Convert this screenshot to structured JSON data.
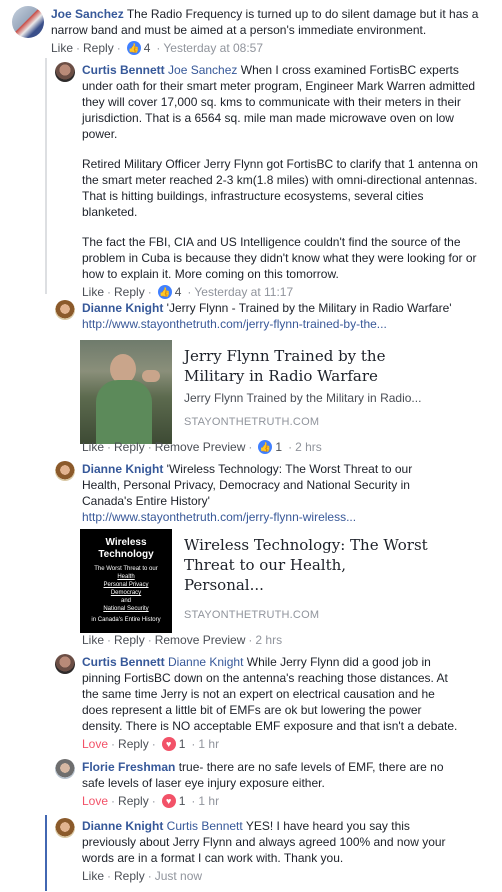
{
  "comments": [
    {
      "author": "Joe Sanchez",
      "text": "The Radio Frequency is turned up to do silent damage but it has a narrow band and must be aimed at a person's immediate environment.",
      "actions": {
        "like": "Like",
        "reply": "Reply",
        "reactions": "4",
        "time": "Yesterday at 08:57"
      }
    },
    {
      "author": "Curtis Bennett",
      "mention": "Joe Sanchez",
      "paragraphs": [
        "When I cross examined FortisBC experts under oath for their smart meter program, Engineer Mark Warren admitted they will cover 17,000 sq. kms to communicate with their meters in their jurisdiction. That is a 6564 sq. mile man made microwave oven on low power.",
        "Retired Military Officer Jerry Flynn got FortisBC to clarify that 1 antenna on the smart meter reached 2-3 km(1.8 miles) with omni-directional antennas. That is hitting buildings, infrastructure ecosystems, several cities blanketed.",
        "The fact the FBI, CIA and US Intelligence couldn't find the source of the problem in Cuba is because they didn't know what they were looking for or how to explain it. More coming on this tomorrow."
      ],
      "actions": {
        "like": "Like",
        "reply": "Reply",
        "reactions": "4",
        "time": "Yesterday at 11:17"
      }
    },
    {
      "author": "Dianne Knight",
      "text": "'Jerry Flynn - Trained by the Military in Radio Warfare'",
      "link": "http://www.stayonthetruth.com/jerry-flynn-trained-by-the...",
      "preview": {
        "title": "Jerry Flynn Trained by the Military in Radio Warfare",
        "desc": "Jerry Flynn Trained by the Military in Radio...",
        "domain": "STAYONTHETRUTH.COM"
      },
      "actions": {
        "like": "Like",
        "reply": "Reply",
        "remove": "Remove Preview",
        "reactions": "1",
        "time": "2 hrs"
      }
    },
    {
      "author": "Dianne Knight",
      "text": "'Wireless Technology: The Worst Threat to our Health, Personal Privacy, Democracy and National Security in Canada's Entire History'",
      "link": "http://www.stayonthetruth.com/jerry-flynn-wireless...",
      "preview": {
        "title": "Wireless Technology: The Worst Threat to our Health, Personal...",
        "domain": "STAYONTHETRUTH.COM",
        "thumb_lines": [
          "Wireless Technology",
          "The Worst Threat to our",
          "Health",
          "Personal Privacy",
          "Democracy",
          "and",
          "National Security",
          "in Canada's Entire History"
        ]
      },
      "actions": {
        "like": "Like",
        "reply": "Reply",
        "remove": "Remove Preview",
        "time": "2 hrs"
      }
    },
    {
      "author": "Curtis Bennett",
      "mention": "Dianne Knight",
      "text": "While Jerry Flynn did a good job in pinning FortisBC down on the antenna's reaching those distances. At the same time Jerry is not an expert on electrical causation and he does represent a little bit of EMFs are ok but lowering the power density. There is NO acceptable EMF exposure and that isn't a debate.",
      "actions": {
        "like": "Love",
        "reply": "Reply",
        "reactions": "1",
        "time": "1 hr"
      }
    },
    {
      "author": "Florie Freshman",
      "text": "true- there are no safe levels of EMF, there are no safe levels of laser eye injury exposure either.",
      "actions": {
        "like": "Love",
        "reply": "Reply",
        "reactions": "1",
        "time": "1 hr"
      }
    },
    {
      "author": "Dianne Knight",
      "mention": "Curtis Bennett",
      "text": "YES! I have heard you say this previously about Jerry Flynn and always agreed 100% and now your words are in a format I can work with. Thank you.",
      "actions": {
        "like": "Like",
        "reply": "Reply",
        "time": "Just now"
      }
    }
  ],
  "colors": {
    "link": "#365899",
    "meta": "#90949c",
    "love": "#f25268",
    "like_badge": "#4080ff"
  }
}
